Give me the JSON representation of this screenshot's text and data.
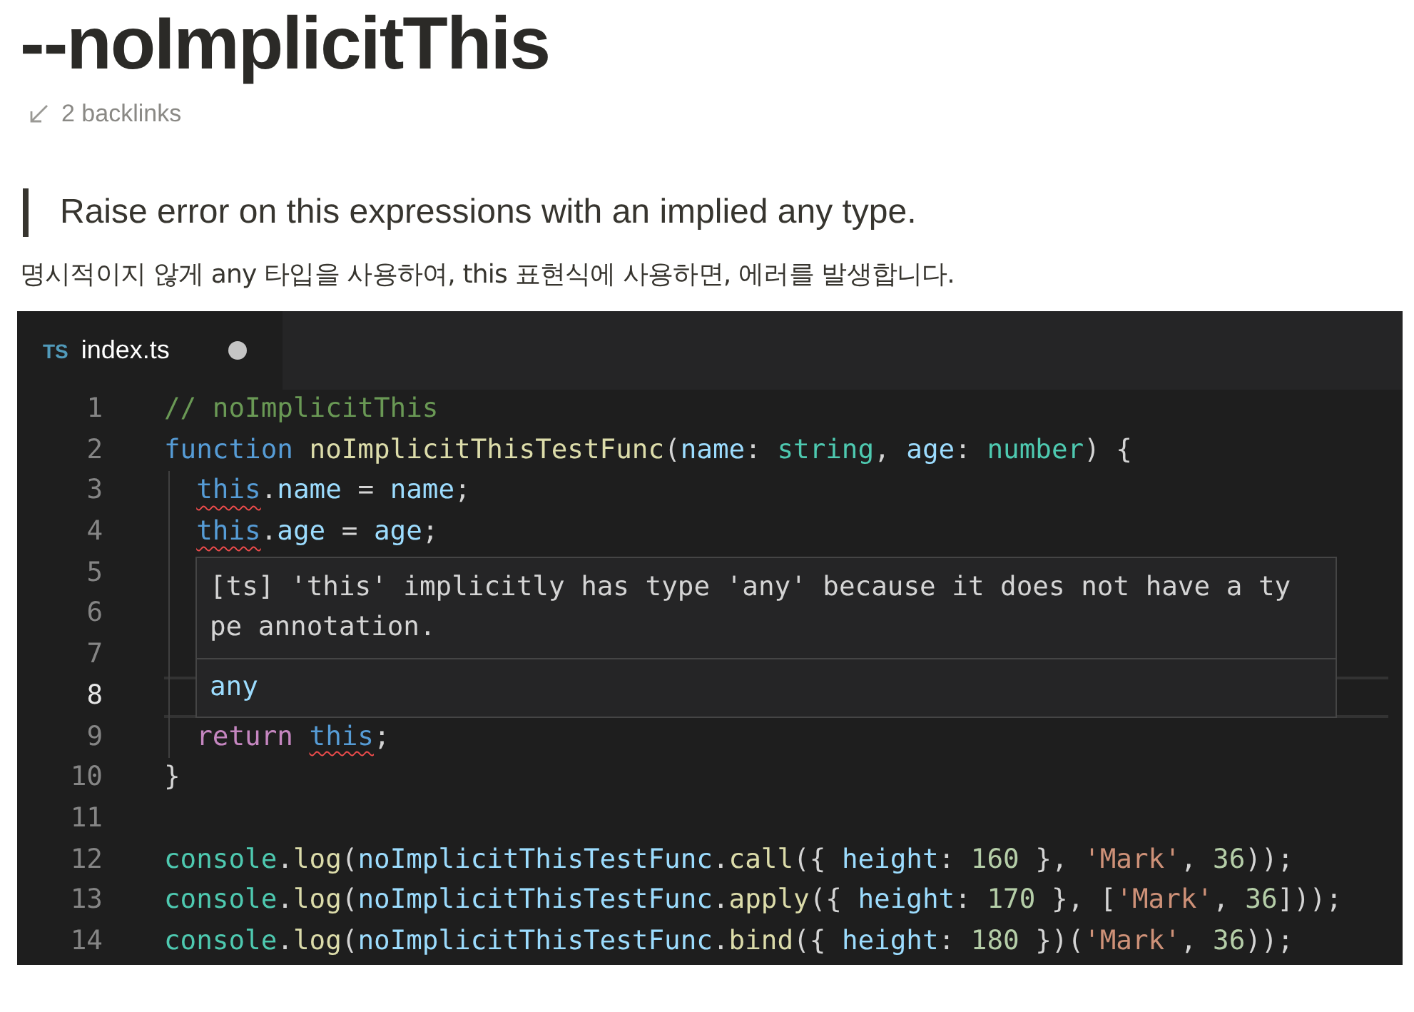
{
  "page": {
    "title": "--noImplicitThis",
    "backlinks": "2 backlinks",
    "quote": "Raise error on this expressions with an implied any type.",
    "description": "명시적이지 않게 any 타입을 사용하여, this 표현식에 사용하면, 에러를 발생합니다."
  },
  "editor": {
    "tab": {
      "badge": "TS",
      "label": "index.ts",
      "modified": true,
      "selected": true
    },
    "lines": [
      {
        "number": "1",
        "indented": false,
        "current": false,
        "tokens": [
          {
            "kind": "comment",
            "text": "// noImplicitThis"
          }
        ]
      },
      {
        "number": "2",
        "indented": false,
        "current": false,
        "tokens": [
          {
            "kind": "keyword",
            "text": "function "
          },
          {
            "kind": "function",
            "text": "noImplicitThisTestFunc"
          },
          {
            "kind": "plain",
            "text": "("
          },
          {
            "kind": "variable",
            "text": "name"
          },
          {
            "kind": "plain",
            "text": ": "
          },
          {
            "kind": "type",
            "text": "string"
          },
          {
            "kind": "plain",
            "text": ", "
          },
          {
            "kind": "variable",
            "text": "age"
          },
          {
            "kind": "plain",
            "text": ": "
          },
          {
            "kind": "type",
            "text": "number"
          },
          {
            "kind": "plain",
            "text": ") {"
          }
        ]
      },
      {
        "number": "3",
        "indented": true,
        "current": false,
        "tokens": [
          {
            "kind": "this-error",
            "text": "this"
          },
          {
            "kind": "plain",
            "text": "."
          },
          {
            "kind": "variable",
            "text": "name"
          },
          {
            "kind": "plain",
            "text": " = "
          },
          {
            "kind": "variable",
            "text": "name"
          },
          {
            "kind": "plain",
            "text": ";"
          }
        ]
      },
      {
        "number": "4",
        "indented": true,
        "current": false,
        "tokens": [
          {
            "kind": "this-error",
            "text": "this"
          },
          {
            "kind": "plain",
            "text": "."
          },
          {
            "kind": "variable",
            "text": "age"
          },
          {
            "kind": "plain",
            "text": " = "
          },
          {
            "kind": "variable",
            "text": "age"
          },
          {
            "kind": "plain",
            "text": ";"
          }
        ]
      },
      {
        "number": "5",
        "indented": true,
        "current": false
      },
      {
        "number": "6",
        "indented": true,
        "current": false
      },
      {
        "number": "7",
        "indented": true,
        "current": false
      },
      {
        "number": "8",
        "indented": true,
        "current": true
      },
      {
        "number": "9",
        "indented": true,
        "current": false,
        "tokens": [
          {
            "kind": "control",
            "text": "return "
          },
          {
            "kind": "this-error",
            "text": "this"
          },
          {
            "kind": "plain",
            "text": ";"
          }
        ]
      },
      {
        "number": "10",
        "indented": false,
        "current": false,
        "tokens": [
          {
            "kind": "plain",
            "text": "}"
          }
        ]
      },
      {
        "number": "11",
        "indented": false,
        "current": false
      },
      {
        "number": "12",
        "indented": false,
        "current": false,
        "tokens": [
          {
            "kind": "class",
            "text": "console"
          },
          {
            "kind": "plain",
            "text": "."
          },
          {
            "kind": "function",
            "text": "log"
          },
          {
            "kind": "plain",
            "text": "("
          },
          {
            "kind": "variable",
            "text": "noImplicitThisTestFunc"
          },
          {
            "kind": "plain",
            "text": "."
          },
          {
            "kind": "function",
            "text": "call"
          },
          {
            "kind": "plain",
            "text": "({ "
          },
          {
            "kind": "variable",
            "text": "height"
          },
          {
            "kind": "plain",
            "text": ": "
          },
          {
            "kind": "number",
            "text": "160"
          },
          {
            "kind": "plain",
            "text": " }, "
          },
          {
            "kind": "string",
            "text": "'Mark'"
          },
          {
            "kind": "plain",
            "text": ", "
          },
          {
            "kind": "number",
            "text": "36"
          },
          {
            "kind": "plain",
            "text": "));"
          }
        ]
      },
      {
        "number": "13",
        "indented": false,
        "current": false,
        "tokens": [
          {
            "kind": "class",
            "text": "console"
          },
          {
            "kind": "plain",
            "text": "."
          },
          {
            "kind": "function",
            "text": "log"
          },
          {
            "kind": "plain",
            "text": "("
          },
          {
            "kind": "variable",
            "text": "noImplicitThisTestFunc"
          },
          {
            "kind": "plain",
            "text": "."
          },
          {
            "kind": "function",
            "text": "apply"
          },
          {
            "kind": "plain",
            "text": "({ "
          },
          {
            "kind": "variable",
            "text": "height"
          },
          {
            "kind": "plain",
            "text": ": "
          },
          {
            "kind": "number",
            "text": "170"
          },
          {
            "kind": "plain",
            "text": " }, ["
          },
          {
            "kind": "string",
            "text": "'Mark'"
          },
          {
            "kind": "plain",
            "text": ", "
          },
          {
            "kind": "number",
            "text": "36"
          },
          {
            "kind": "plain",
            "text": "]));"
          }
        ]
      },
      {
        "number": "14",
        "indented": false,
        "current": false,
        "tokens": [
          {
            "kind": "class",
            "text": "console"
          },
          {
            "kind": "plain",
            "text": "."
          },
          {
            "kind": "function",
            "text": "log"
          },
          {
            "kind": "plain",
            "text": "("
          },
          {
            "kind": "variable",
            "text": "noImplicitThisTestFunc"
          },
          {
            "kind": "plain",
            "text": "."
          },
          {
            "kind": "function",
            "text": "bind"
          },
          {
            "kind": "plain",
            "text": "({ "
          },
          {
            "kind": "variable",
            "text": "height"
          },
          {
            "kind": "plain",
            "text": ": "
          },
          {
            "kind": "number",
            "text": "180"
          },
          {
            "kind": "plain",
            "text": " })("
          },
          {
            "kind": "string",
            "text": "'Mark'"
          },
          {
            "kind": "plain",
            "text": ", "
          },
          {
            "kind": "number",
            "text": "36"
          },
          {
            "kind": "plain",
            "text": "));"
          }
        ]
      }
    ],
    "tooltip": {
      "message": "[ts] 'this' implicitly has type 'any' because it does not have a type annotation.",
      "type": "any"
    }
  }
}
